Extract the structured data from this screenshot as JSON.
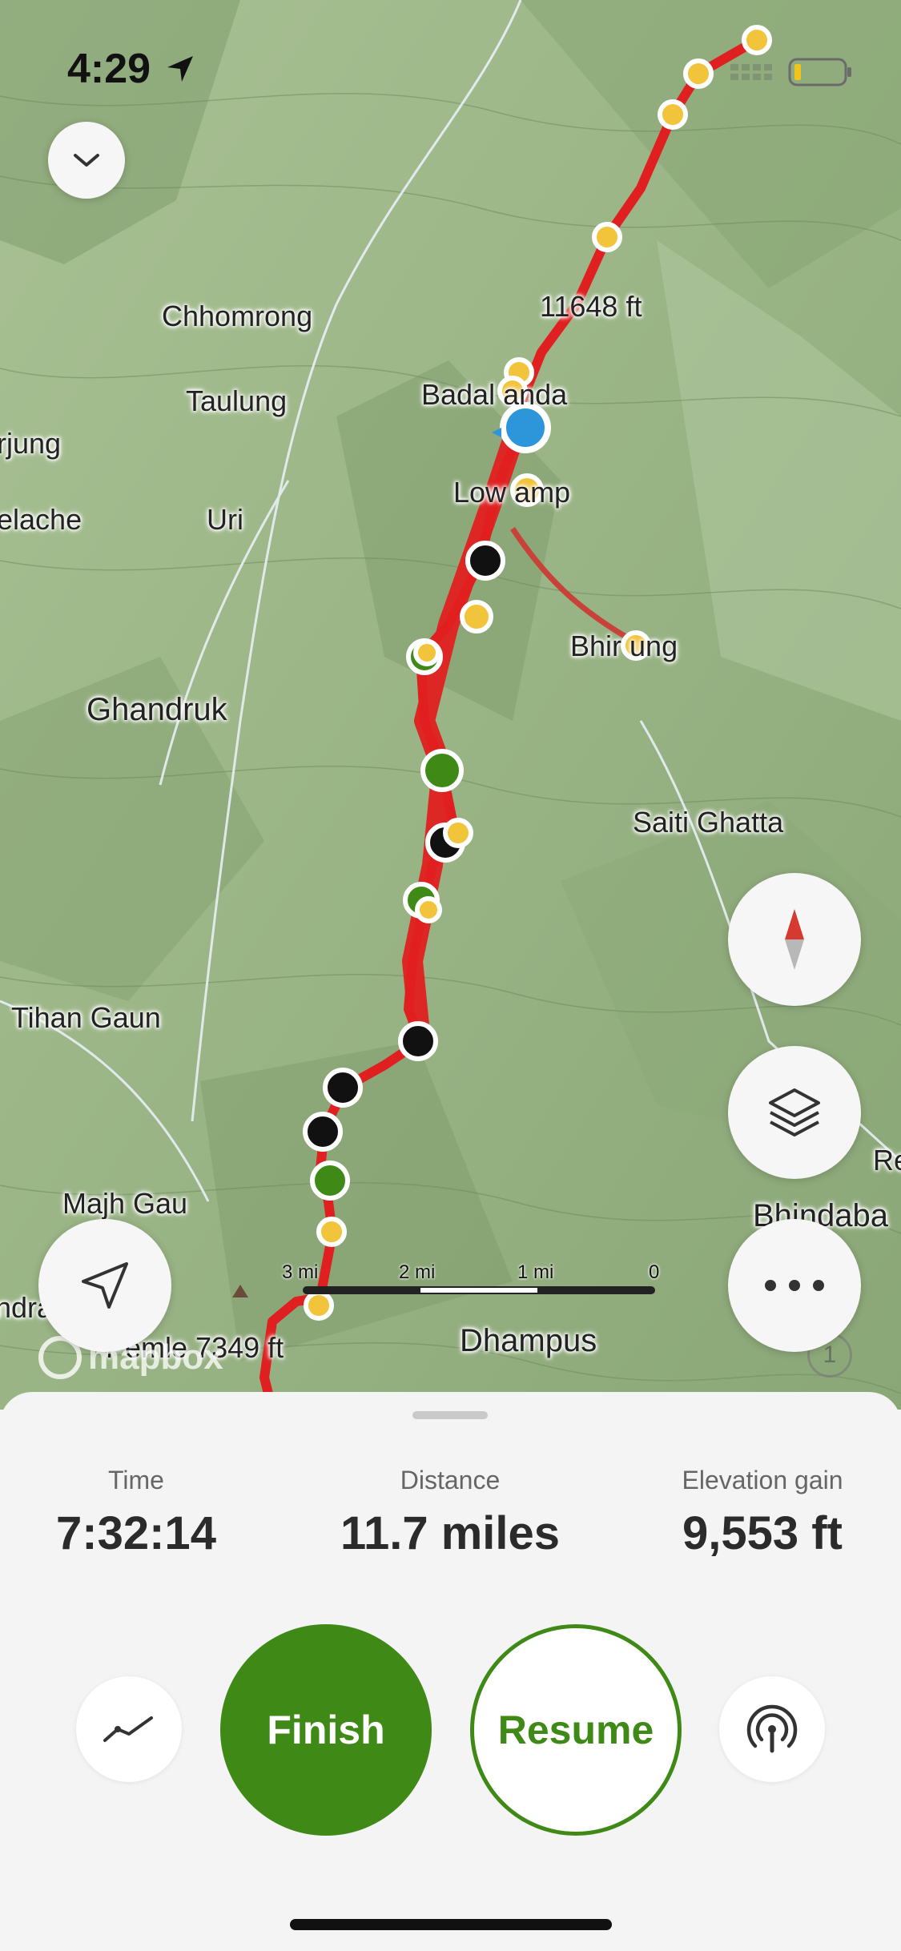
{
  "status_bar": {
    "time": "4:29"
  },
  "map": {
    "places": {
      "chhomrong": "Chhomrong",
      "taulung": "Taulung",
      "rjung": "rjung",
      "elache": "elache",
      "uri": "Uri",
      "ghandruk": "Ghandruk",
      "tihan_gaun": "Tihan Gaun",
      "majh_gau": "Majh Gau",
      "ndra": "ndra",
      "badal_danda": "Badal anda",
      "low_camp": "Low amp",
      "bhirjung": "Bhir ung",
      "saiti_ghatta": "Saiti Ghatta",
      "bhindabas": "Bhindaba",
      "re": "Re",
      "dhampus": "Dhampus"
    },
    "elevation_label": "11648 ft",
    "elevation_label_2": "Pemle 7349 ft",
    "attribution": "mapbox",
    "info_badge": "1",
    "scale": {
      "labels": [
        "3 mi",
        "2 mi",
        "1 mi",
        "0"
      ]
    }
  },
  "stats": {
    "time": {
      "label": "Time",
      "value": "7:32:14"
    },
    "distance": {
      "label": "Distance",
      "value": "11.7 miles"
    },
    "elevation": {
      "label": "Elevation gain",
      "value": "9,553 ft"
    }
  },
  "actions": {
    "finish": "Finish",
    "resume": "Resume"
  },
  "colors": {
    "route": "#e02020",
    "accent_green": "#3f8a17",
    "location_blue": "#2d95d9",
    "waypoint_yellow": "#f2c43c"
  }
}
